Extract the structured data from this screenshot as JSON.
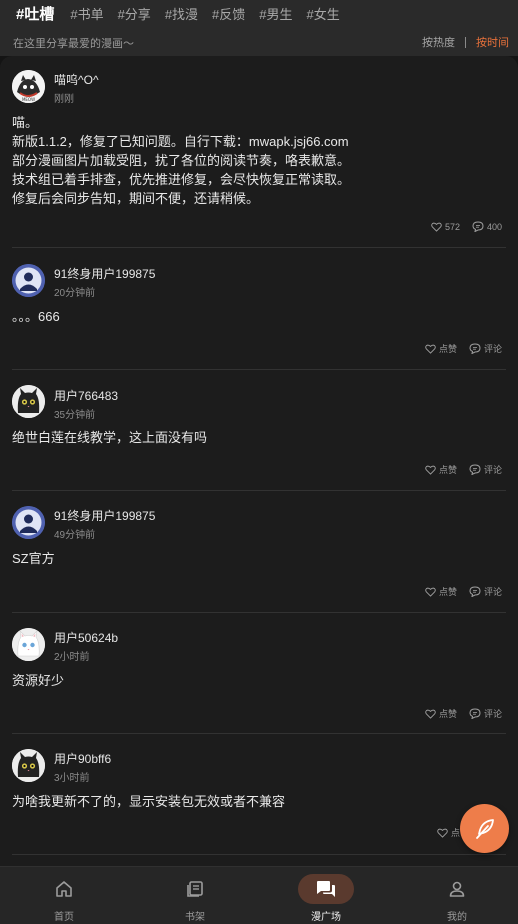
{
  "header": {
    "tabs": [
      {
        "label": "#吐槽",
        "active": true
      },
      {
        "label": "#书单"
      },
      {
        "label": "#分享"
      },
      {
        "label": "#找漫"
      },
      {
        "label": "#反馈"
      },
      {
        "label": "#男生"
      },
      {
        "label": "#女生"
      }
    ],
    "subtitle": "在这里分享最爱的漫画～",
    "sort_hot": "按热度",
    "sort_time": "按时间"
  },
  "posts": [
    {
      "user": "喵呜^O^",
      "time": "刚刚",
      "lines": [
        "喵。",
        "新版1.1.2，修复了已知问题。自行下载：mwapk.jsj66.com",
        "部分漫画图片加载受阻，扰了各位的阅读节奏，咯表歉意。",
        "技术组已着手排查，优先推进修复，会尽快恢复正常读取。",
        "修复后会同步告知，期间不便，还请稍候。"
      ],
      "likes": "572",
      "comments": "400",
      "avatar": "logo-avatar"
    },
    {
      "user": "91终身用户199875",
      "time": "20分钟前",
      "lines": [
        "。。。666"
      ],
      "likes": "点赞",
      "comments": "评论",
      "avatar": "default-user-avatar"
    },
    {
      "user": "用户766483",
      "time": "35分钟前",
      "lines": [
        "绝世白莲在线教学，这上面没有吗"
      ],
      "likes": "点赞",
      "comments": "评论",
      "avatar": "black-cat-avatar"
    },
    {
      "user": "91终身用户199875",
      "time": "49分钟前",
      "lines": [
        "SZ官方"
      ],
      "likes": "点赞",
      "comments": "评论",
      "avatar": "default-user-avatar"
    },
    {
      "user": "用户50624b",
      "time": "2小时前",
      "lines": [
        "资源好少"
      ],
      "likes": "点赞",
      "comments": "评论",
      "avatar": "white-cat-avatar"
    },
    {
      "user": "用户90bff6",
      "time": "3小时前",
      "lines": [
        "为啥我更新不了的，显示安装包无效或者不兼容"
      ],
      "likes": "点",
      "comments": "",
      "avatar": "black-cat-avatar"
    }
  ],
  "fab": {
    "icon": "feather-pen-icon"
  },
  "nav": [
    {
      "label": "首页",
      "icon": "home-icon"
    },
    {
      "label": "书架",
      "icon": "bookshelf-icon"
    },
    {
      "label": "漫广场",
      "icon": "chat-square-icon",
      "active": true
    },
    {
      "label": "我的",
      "icon": "profile-icon"
    }
  ],
  "colors": {
    "accent": "#e8713b",
    "background": "#1c1c1c",
    "header": "#2a2a2a",
    "fab": "#ee7d4a"
  }
}
